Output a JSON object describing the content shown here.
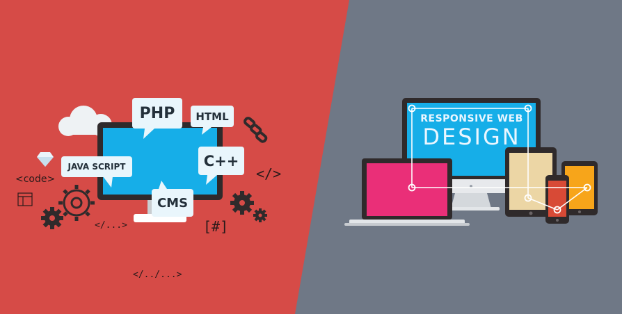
{
  "colors": {
    "left_bg": "#d64b47",
    "right_bg": "#6f7886",
    "monitor_screen": "#16aee8",
    "dark": "#2f2a2b",
    "bubble": "#e9f6fc",
    "laptop_screen": "#ea2f78",
    "tablet_screen": "#ecd6a5",
    "phone_screen": "#f7a51a",
    "small_phone_screen": "#d84a36"
  },
  "left": {
    "bubbles": {
      "php": "PHP",
      "html": "HTML",
      "cpp": "C++",
      "java": "JAVA SCRIPT",
      "cms": "CMS"
    },
    "code_label": "<code>",
    "hash_label": "[#]",
    "tag_close": "</>",
    "tag_dots": "</...>",
    "tag_path": "</../...>"
  },
  "right": {
    "title_line1": "RESPONSIVE WEB",
    "title_line2": "DESIGN"
  }
}
